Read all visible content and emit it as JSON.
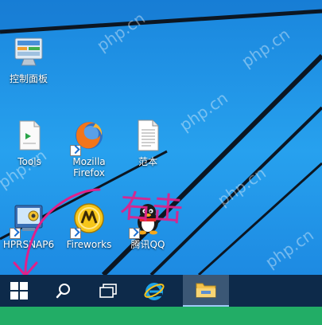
{
  "desktop": {
    "icons": [
      {
        "label": "控制面板",
        "icon": "control-panel-icon"
      },
      {
        "label": "Tools",
        "icon": "tools-folder-icon"
      },
      {
        "label": "Mozilla\nFirefox",
        "icon": "firefox-icon"
      },
      {
        "label": "范本",
        "icon": "document-icon"
      },
      {
        "label": "HPRSNAP6",
        "icon": "hprsnap-icon"
      },
      {
        "label": "Fireworks",
        "icon": "fireworks-icon"
      },
      {
        "label": "腾讯QQ",
        "icon": "qq-penguin-icon"
      }
    ]
  },
  "watermark": {
    "text": "php.cn"
  },
  "annotation": {
    "text": "右击",
    "color": "#e0218a"
  },
  "taskbar": {
    "items": [
      {
        "name": "start",
        "icon": "windows-logo-icon"
      },
      {
        "name": "search",
        "icon": "search-icon"
      },
      {
        "name": "task-view",
        "icon": "task-view-icon"
      },
      {
        "name": "internet-explorer",
        "icon": "internet-explorer-icon"
      },
      {
        "name": "file-explorer",
        "icon": "file-explorer-icon",
        "active": true
      }
    ]
  },
  "colors": {
    "taskbar": "#0d2a4a",
    "desktop": "#1f8fe3",
    "bottom_strip": "#22ad66"
  }
}
